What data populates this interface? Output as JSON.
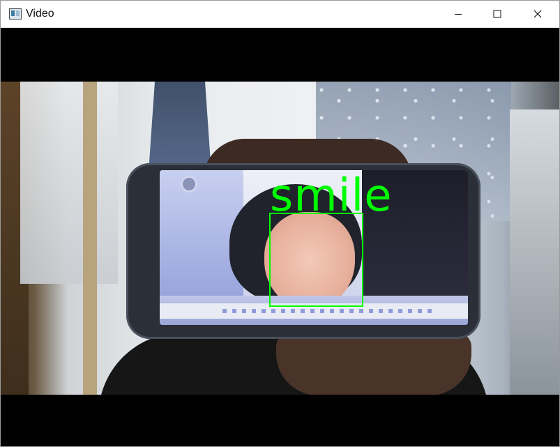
{
  "window": {
    "title": "Video",
    "icon": "app-icon",
    "controls": {
      "minimize_icon": "minimize-icon",
      "maximize_icon": "maximize-icon",
      "close_icon": "close-icon"
    }
  },
  "video": {
    "detection_label": "smile",
    "detection_color": "#00ff00"
  }
}
